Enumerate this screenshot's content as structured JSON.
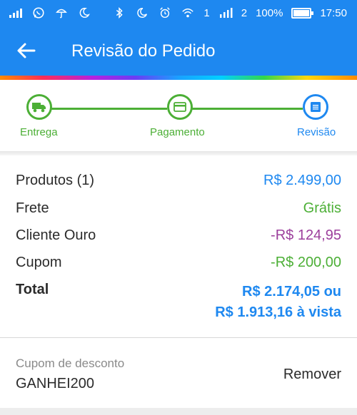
{
  "status_bar": {
    "battery_percent": "100%",
    "time": "17:50",
    "sim1": "1",
    "sim2": "2"
  },
  "header": {
    "title": "Revisão do Pedido",
    "background": "#1e88f0"
  },
  "stepper": {
    "steps": [
      {
        "label": "Entrega",
        "icon": "truck-icon",
        "color": "#4caf36"
      },
      {
        "label": "Pagamento",
        "icon": "credit-card-icon",
        "color": "#4caf36"
      },
      {
        "label": "Revisão",
        "icon": "list-icon",
        "color": "#1e88f0"
      }
    ]
  },
  "summary": {
    "products_label": "Produtos (1)",
    "products_value": "R$ 2.499,00",
    "shipping_label": "Frete",
    "shipping_value": "Grátis",
    "gold_label": "Cliente Ouro",
    "gold_value": "-R$ 124,95",
    "coupon_label": "Cupom",
    "coupon_value": "-R$ 200,00",
    "total_label": "Total",
    "total_value": "R$ 2.174,05 ou",
    "total_cash": "R$ 1.913,16 à vista"
  },
  "coupon": {
    "label": "Cupom de desconto",
    "code": "GANHEI200",
    "remove_label": "Remover"
  },
  "colors": {
    "blue": "#1e88f0",
    "green": "#4caf36",
    "purple": "#9c3f9c"
  }
}
